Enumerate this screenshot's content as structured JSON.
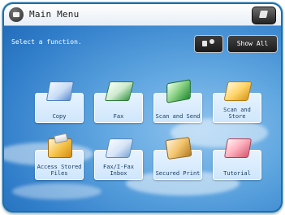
{
  "window": {
    "title": "Main Menu"
  },
  "header": {
    "instruction": "Select a function.",
    "show_all_label": "Show All"
  },
  "functions": [
    {
      "label": "Copy",
      "icon": "copy-icon"
    },
    {
      "label": "Fax",
      "icon": "fax-icon"
    },
    {
      "label": "Scan and Send",
      "icon": "scan-and-send-icon"
    },
    {
      "label": "Scan and Store",
      "icon": "scan-and-store-icon"
    },
    {
      "label": "Access Stored Files",
      "icon": "access-stored-files-icon"
    },
    {
      "label": "Fax/I-Fax Inbox",
      "icon": "fax-inbox-icon"
    },
    {
      "label": "Secured Print",
      "icon": "secured-print-icon"
    },
    {
      "label": "Tutorial",
      "icon": "tutorial-icon"
    }
  ],
  "icons": {
    "home": "home-icon",
    "logout": "logout-icon",
    "rearrange": "rearrange-icon"
  },
  "colors": {
    "frame": "#1f6fa3",
    "tile_label_bg": "#d9ecfc",
    "tile_label_text": "#14385f",
    "header_button_bg": "#2a2a2a"
  }
}
